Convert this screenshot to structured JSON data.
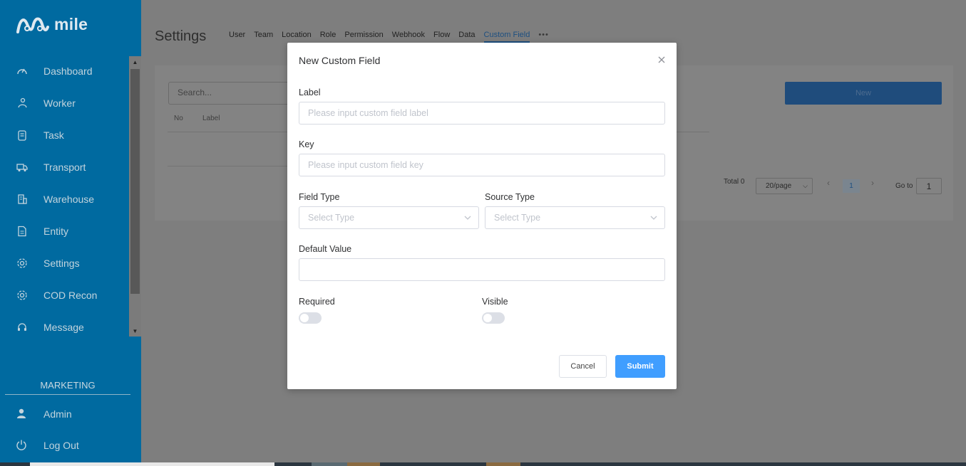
{
  "brand": {
    "name": "mile"
  },
  "sidebar": {
    "items": [
      {
        "label": "Dashboard",
        "icon": "speedometer-icon"
      },
      {
        "label": "Worker",
        "icon": "worker-icon"
      },
      {
        "label": "Task",
        "icon": "clipboard-icon"
      },
      {
        "label": "Transport",
        "icon": "truck-icon"
      },
      {
        "label": "Warehouse",
        "icon": "building-icon"
      },
      {
        "label": "Entity",
        "icon": "document-icon"
      },
      {
        "label": "Settings",
        "icon": "gear-icon"
      },
      {
        "label": "COD Recon",
        "icon": "gear-icon"
      },
      {
        "label": "Message",
        "icon": "headset-icon"
      }
    ],
    "section_label": "MARKETING",
    "bottom": [
      {
        "label": "Admin",
        "icon": "user-icon"
      },
      {
        "label": "Log Out",
        "icon": "power-icon"
      }
    ]
  },
  "page": {
    "title": "Settings",
    "tabs": [
      "User",
      "Team",
      "Location",
      "Role",
      "Permission",
      "Webhook",
      "Flow",
      "Data",
      "Custom Field"
    ],
    "active_tab": "Custom Field",
    "more": "•••",
    "search_placeholder": "Search...",
    "new_button": "New",
    "columns": [
      "No",
      "Label"
    ],
    "pagination": {
      "total": "Total 0",
      "page_size": "20/page",
      "current": "1",
      "goto_label": "Go to",
      "goto_value": "1"
    }
  },
  "modal": {
    "title": "New Custom Field",
    "label_field": {
      "label": "Label",
      "placeholder": "Please input custom field label"
    },
    "key_field": {
      "label": "Key",
      "placeholder": "Please input custom field key"
    },
    "field_type": {
      "label": "Field Type",
      "placeholder": "Select Type"
    },
    "source_type": {
      "label": "Source Type",
      "placeholder": "Select Type"
    },
    "default_value": {
      "label": "Default Value",
      "value": ""
    },
    "required": {
      "label": "Required",
      "on": false
    },
    "visible": {
      "label": "Visible",
      "on": false
    },
    "cancel": "Cancel",
    "submit": "Submit"
  },
  "colors": {
    "sidebar": "#006aa0",
    "primary": "#409eff",
    "overlay": "#7e7e7e"
  }
}
